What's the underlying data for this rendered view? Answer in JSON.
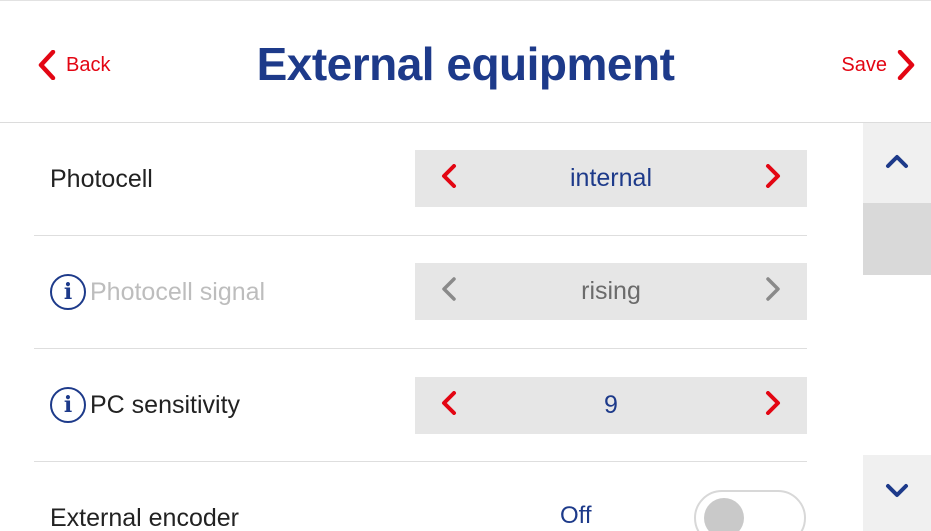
{
  "header": {
    "back_label": "Back",
    "title": "External equipment",
    "save_label": "Save"
  },
  "rows": [
    {
      "label": "Photocell",
      "value": "internal",
      "has_info": false,
      "enabled": true
    },
    {
      "label": "Photocell signal",
      "value": "rising",
      "has_info": true,
      "enabled": false
    },
    {
      "label": "PC sensitivity",
      "value": "9",
      "has_info": true,
      "enabled": true
    },
    {
      "label": "External encoder",
      "value": "Off",
      "type": "toggle",
      "toggle_on": false
    }
  ],
  "icons": {
    "info": "info-icon",
    "back": "chevron-left-icon",
    "save": "chevron-right-icon",
    "scroll_up": "chevron-up-icon",
    "scroll_down": "chevron-down-icon"
  },
  "colors": {
    "accent_red": "#e30613",
    "primary_blue": "#1d3a8a",
    "disabled_gray": "#bdbdbd",
    "selector_bg": "#e6e6e6"
  }
}
